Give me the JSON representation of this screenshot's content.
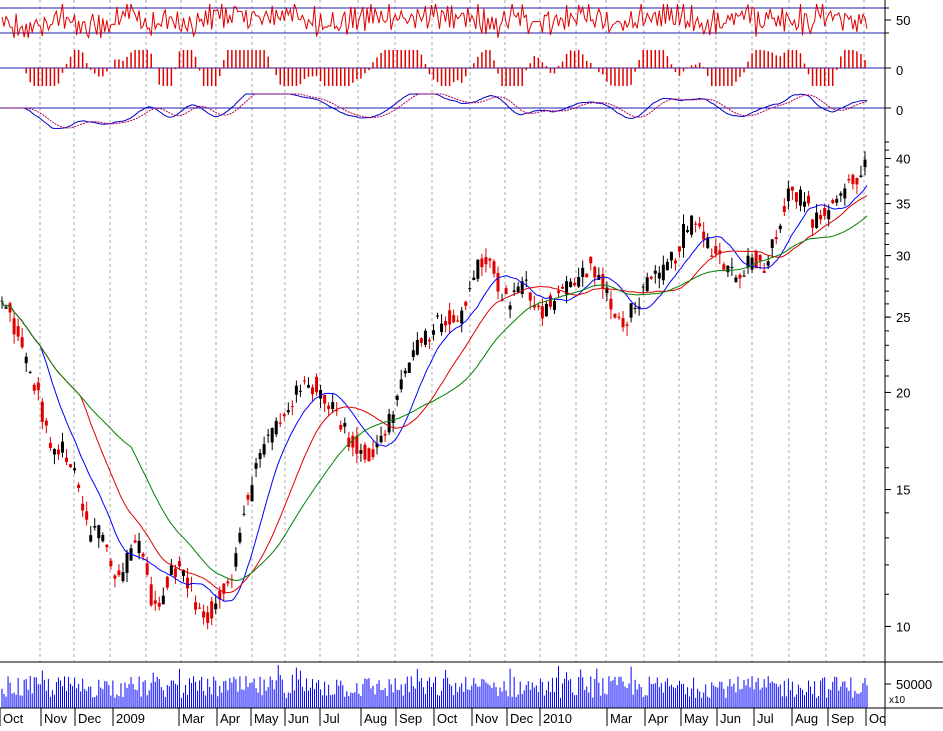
{
  "chart_data": {
    "type": "stock-chart",
    "colors": {
      "grid": "#aaaaaa",
      "border": "#000000",
      "axis_line": "#1f1fae",
      "up_candle": "#000000",
      "down_candle": "#e00000",
      "oscillator": "#e00000",
      "histogram": "#e00000",
      "macd_line": "#0000c8",
      "signal_line": "#b00060",
      "ma_fast": "#0000ff",
      "ma_mid": "#e00000",
      "ma_slow": "#008000",
      "volume": "#0000ff"
    },
    "x_axis": {
      "labels": [
        "Oct",
        "Nov",
        "Dec",
        "2009",
        "Mar",
        "Apr",
        "May",
        "Jun",
        "Jul",
        "Aug",
        "Sep",
        "Oct",
        "Nov",
        "Dec",
        "2010",
        "Mar",
        "Apr",
        "May",
        "Jun",
        "Jul",
        "Aug",
        "Sep",
        "Oc"
      ]
    },
    "panels": {
      "oscillator": {
        "tick_labels": [
          "50"
        ],
        "levels": [
          70,
          50
        ]
      },
      "histogram": {
        "tick_labels": [
          "0"
        ]
      },
      "macd": {
        "tick_labels": [
          "0"
        ]
      },
      "price": {
        "scale": "log",
        "ylim": [
          9,
          42
        ],
        "tick_labels": [
          "40",
          "35",
          "30",
          "25",
          "20",
          "15",
          "10"
        ],
        "tick_values": [
          40,
          35,
          30,
          25,
          20,
          15,
          10
        ]
      },
      "volume": {
        "tick_labels": [
          "50000"
        ],
        "unit_label": "x10"
      }
    },
    "price_series": {
      "close_weekly": [
        26,
        25,
        23,
        21.5,
        20,
        18,
        16.5,
        17,
        16,
        14.5,
        13,
        13.5,
        12.5,
        11.5,
        12,
        13,
        12.5,
        11,
        10.5,
        11.5,
        12,
        11.5,
        10.8,
        10.2,
        10.5,
        11,
        11.5,
        12.5,
        14.5,
        16,
        17,
        18,
        18.5,
        19.5,
        20,
        20.5,
        20.2,
        19.8,
        19,
        18,
        17.2,
        16.8,
        16.5,
        17,
        18,
        19.5,
        21,
        22.5,
        23,
        24,
        24.5,
        25,
        24,
        26,
        28,
        30,
        29,
        27,
        26,
        27,
        27.5,
        26,
        25.5,
        26.5,
        27,
        27.5,
        28,
        29,
        28.5,
        27,
        25,
        24.5,
        25.5,
        26.5,
        27.5,
        28,
        29,
        30,
        32,
        33,
        32,
        31,
        30,
        29,
        28.5,
        29,
        30,
        29,
        30.5,
        33,
        37,
        36,
        35,
        33,
        34,
        35,
        36,
        37,
        38,
        39.5
      ]
    }
  }
}
